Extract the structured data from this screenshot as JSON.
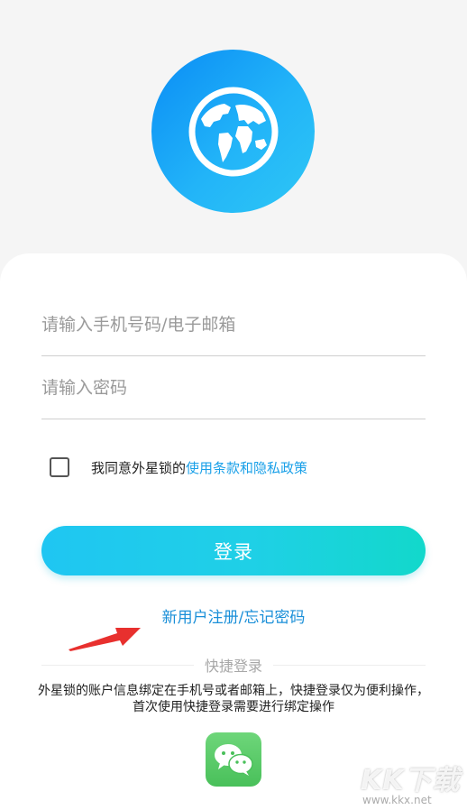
{
  "logo": {
    "icon": "globe-icon",
    "gradient": [
      "#0a8cf5",
      "#2ec7f5"
    ]
  },
  "form": {
    "account_placeholder": "请输入手机号码/电子邮箱",
    "password_placeholder": "请输入密码"
  },
  "agreement": {
    "checked": false,
    "text": "我同意外星锁的",
    "link": "使用条款和隐私政策"
  },
  "login_button": {
    "label": "登录",
    "gradient": [
      "#1fc6f2",
      "#12d8cb"
    ]
  },
  "links": {
    "label": "新用户注册/忘记密码"
  },
  "quick_login": {
    "title": "快捷登录",
    "notice": "外星锁的账户信息绑定在手机号或者邮箱上，快捷登录仅为便利操作，首次使用快捷登录需要进行绑定操作",
    "wechat_icon": "wechat-icon"
  },
  "watermark": {
    "brand": "KK下载",
    "url": "www.kkx.net"
  },
  "colors": {
    "accent": "#1aa0e8",
    "link": "#1a8fd8",
    "arrow": "#e8302e"
  }
}
